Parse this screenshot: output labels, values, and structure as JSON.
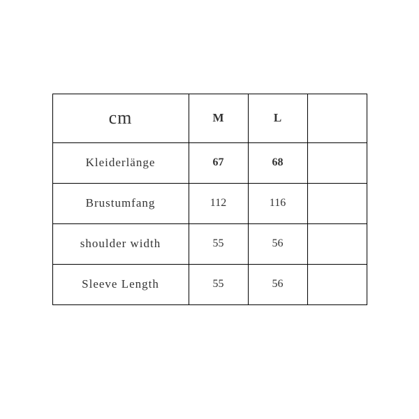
{
  "chart_data": {
    "type": "table",
    "unit_label": "cm",
    "columns": [
      "M",
      "L"
    ],
    "rows": [
      {
        "label": "Kleiderlänge",
        "values": [
          "67",
          "68"
        ],
        "bold": true
      },
      {
        "label": "Brustumfang",
        "values": [
          "112",
          "116"
        ],
        "bold": false
      },
      {
        "label": "shoulder width",
        "values": [
          "55",
          "56"
        ],
        "bold": false
      },
      {
        "label": "Sleeve Length",
        "values": [
          "55",
          "56"
        ],
        "bold": false
      }
    ]
  }
}
